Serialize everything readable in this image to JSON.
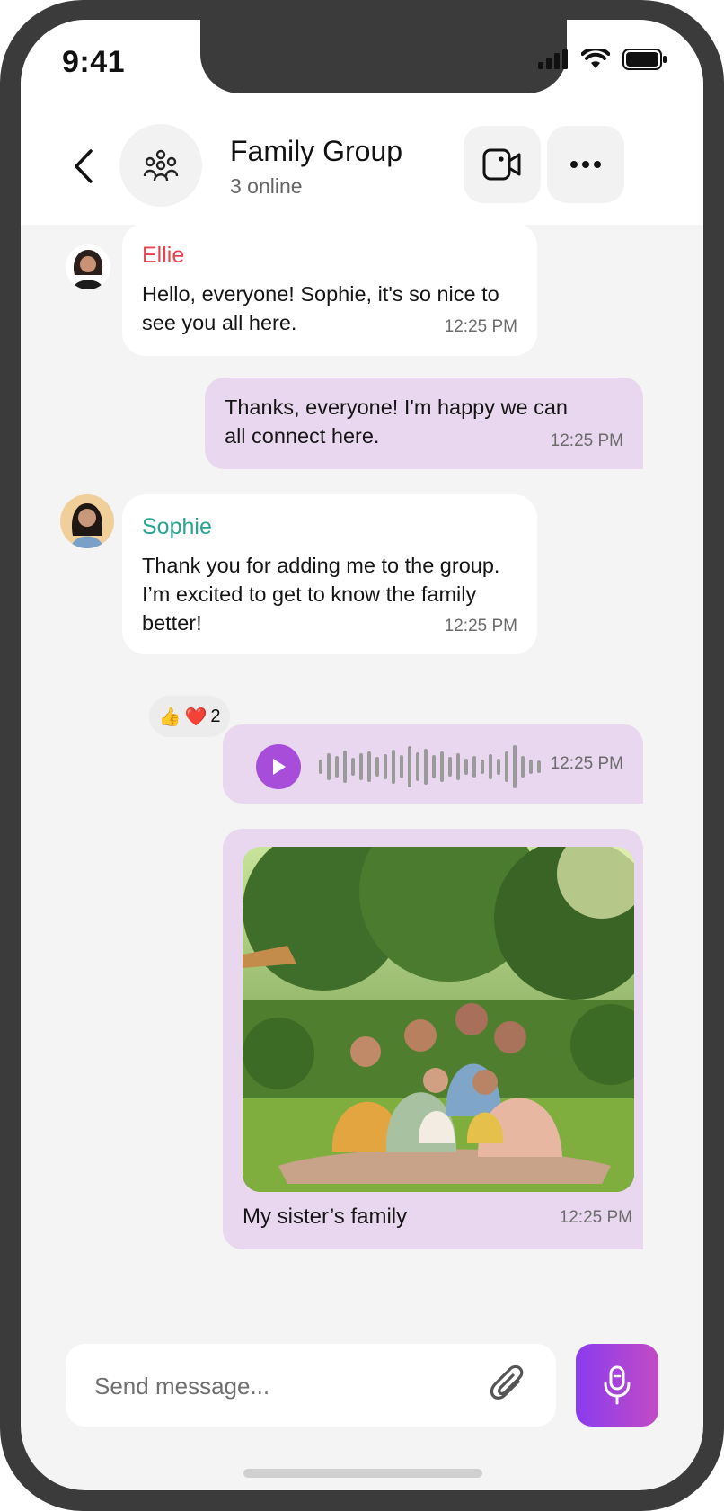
{
  "status_bar": {
    "time": "9:41"
  },
  "header": {
    "title": "Family Group",
    "subtitle": "3 online"
  },
  "messages": [
    {
      "sender": "Ellie",
      "text_line1": "Hello, everyone! Sophie, it's so nice to",
      "text_line2": "see you all here.",
      "time": "12:25 PM"
    },
    {
      "text_line1": "Thanks, everyone! I'm happy we can",
      "text_line2": "all connect here.",
      "time": "12:25 PM"
    },
    {
      "sender": "Sophie",
      "text_line1": "Thank you for adding me to the group.",
      "text_line2": "I’m excited to get to know the family",
      "text_line3": "better!",
      "time": "12:25 PM"
    },
    {
      "voice": true,
      "time": "12:25 PM"
    },
    {
      "caption": "My sister’s family",
      "time": "12:25 PM"
    }
  ],
  "reaction": {
    "emoji_1": "👍",
    "emoji_2": "❤️",
    "count": "2"
  },
  "composer": {
    "placeholder": "Send message..."
  },
  "colors": {
    "ellie": "#e8434e",
    "sophie": "#2aa393",
    "accent": "#a84dd9",
    "bubble_out": "#e9d6ef"
  }
}
